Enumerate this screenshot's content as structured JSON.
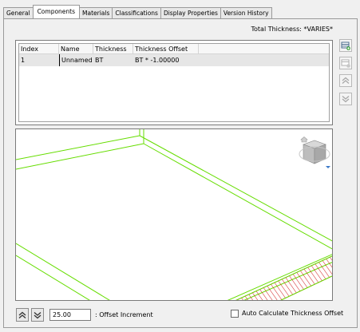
{
  "tabs": [
    "General",
    "Components",
    "Materials",
    "Classifications",
    "Display Properties",
    "Version History"
  ],
  "active_tab": "Components",
  "total_thickness": "Total Thickness: *VARIES*",
  "table": {
    "headers": [
      "Index",
      "Name",
      "Thickness",
      "Thickness Offset"
    ],
    "rows": [
      {
        "index": "1",
        "name": "Unnamed",
        "thickness": "BT",
        "offset": "BT * -1.00000"
      }
    ]
  },
  "side_buttons": [
    "add-component-icon",
    "remove-component-icon",
    "move-up-icon",
    "move-down-icon"
  ],
  "viewcube_icons": [
    "home-icon",
    "viewcube-icon",
    "viewcube-menu-icon"
  ],
  "offset_increment": {
    "value": "25.00",
    "label": ": Offset Increment",
    "up_icon": "increment-up-icon",
    "down_icon": "increment-down-icon"
  },
  "auto_calculate": {
    "label": "Auto Calculate Thickness Offset",
    "checked": false
  },
  "colors": {
    "outline": "#66dd00",
    "hatch": "#cc0000",
    "selected_row": "#e6e6e6"
  }
}
